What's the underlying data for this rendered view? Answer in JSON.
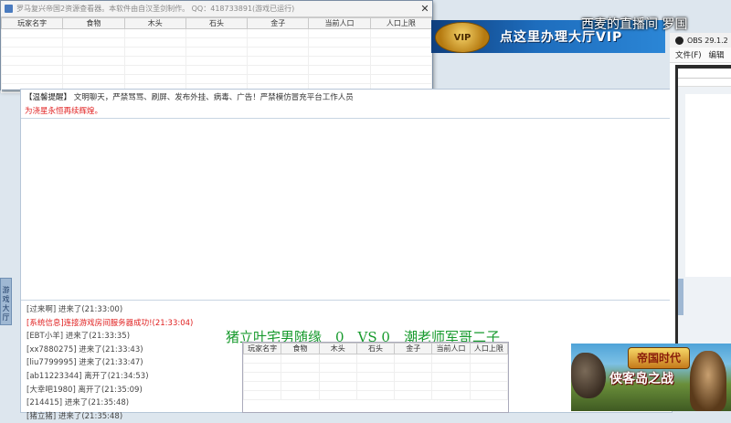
{
  "resource_window": {
    "title": "罗马复兴帝国2资源查看器。本软件由自汉圣剑制作。 QQ：418733891(游戏已运行)",
    "close_glyph": "✕",
    "columns": [
      "玩家名字",
      "食物",
      "木头",
      "石头",
      "金子",
      "当前人口",
      "人口上限"
    ]
  },
  "banner": {
    "badge": "VIP",
    "text": "点这里办理大厅VIP"
  },
  "stream_title": "西麦的直播间 罗国",
  "chat": {
    "notice_label": "【温馨提醒】",
    "notice_text": "文明聊天，严禁骂骂、刷屏、发布外挂、病毒、广告！严禁模仿冒充平台工作人员",
    "warning": "为浇星永恒再续辉煌。",
    "log": [
      {
        "text": "[过来啊] 进来了(21:33:00)",
        "red": false
      },
      {
        "text": "[系统信息]连接游戏房间服务器成功!(21:33:04)",
        "red": true
      },
      {
        "text": "[EBT小羊] 进来了(21:33:35)",
        "red": false
      },
      {
        "text": "[xx7880275] 进来了(21:33:43)",
        "red": false
      },
      {
        "text": "[liu7799995] 进来了(21:33:47)",
        "red": false
      },
      {
        "text": "[ab11223344] 离开了(21:34:53)",
        "red": false
      },
      {
        "text": "[大幸吧1980] 离开了(21:35:09)",
        "red": false
      },
      {
        "text": "[214415] 进来了(21:35:48)",
        "red": false
      },
      {
        "text": "[猪立猪] 进来了(21:35:48)",
        "red": false
      }
    ]
  },
  "lobby_tab": "游戏大厅",
  "score_overlay": "猪立叶宅男随缘　0　VS 0　潮老师军哥二子",
  "small_table": {
    "columns": [
      "玩家名字",
      "食物",
      "木头",
      "石头",
      "金子",
      "当前人口",
      "人口上限"
    ]
  },
  "obs": {
    "title": "OBS 29.1.2",
    "menu": [
      "文件(F)",
      "编辑"
    ]
  },
  "game_ad": {
    "logo": "帝国时代",
    "subtitle": "侠客岛之战"
  }
}
